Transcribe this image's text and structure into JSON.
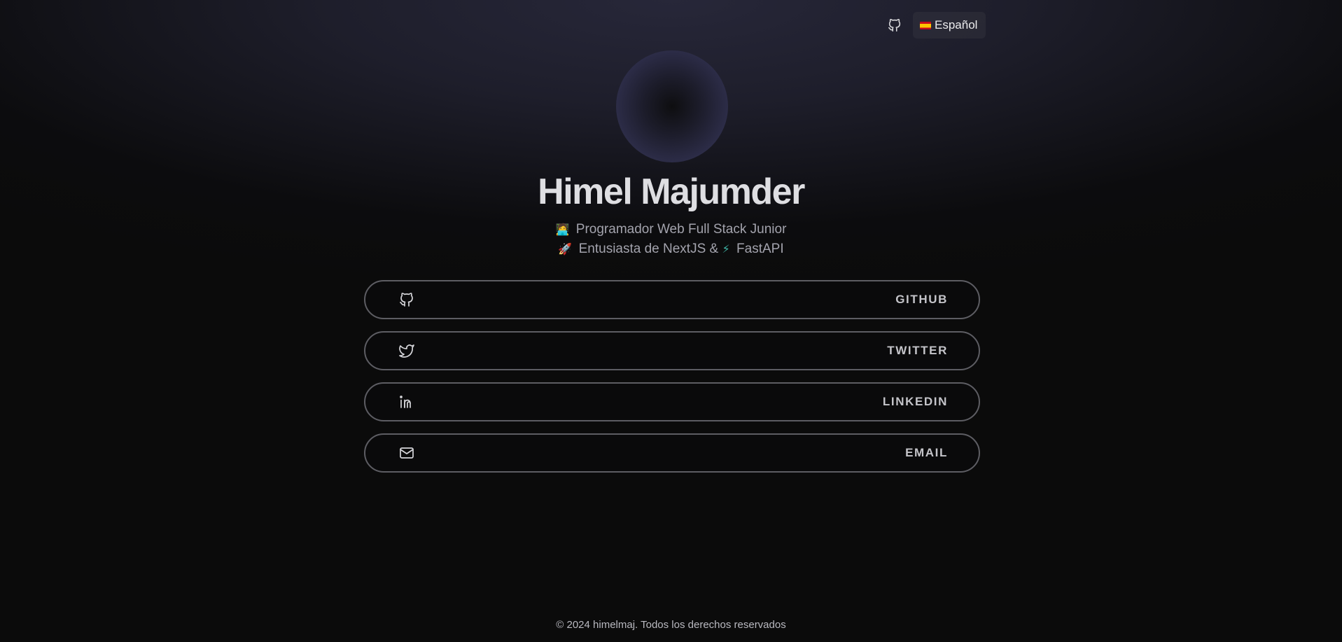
{
  "header": {
    "github_icon": "github-icon",
    "language": {
      "flag": "spain-flag",
      "label": "Español"
    }
  },
  "profile": {
    "name": "Himel Majumder",
    "taglines": [
      {
        "emoji": "🧑‍💻",
        "text": "Programador Web Full Stack Junior"
      },
      {
        "emoji": "🚀",
        "text": "Entusiasta de NextJS &"
      },
      {
        "emoji": "⚡",
        "text": "FastAPI"
      }
    ]
  },
  "links": [
    {
      "icon": "github-icon",
      "label": "GITHUB"
    },
    {
      "icon": "twitter-icon",
      "label": "TWITTER"
    },
    {
      "icon": "linkedin-icon",
      "label": "LINKEDIN"
    },
    {
      "icon": "mail-icon",
      "label": "EMAIL"
    }
  ],
  "footer": {
    "text": "© 2024 himelmaj. Todos los derechos reservados"
  },
  "colors": {
    "background": "#0b0b0b",
    "border": "#5d5d63",
    "name": "#dedee2"
  }
}
